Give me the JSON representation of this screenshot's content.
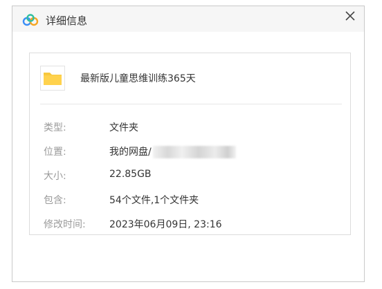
{
  "dialog": {
    "title": "详细信息",
    "app_icon": "cloud-logo-icon",
    "close_icon": "close-icon"
  },
  "file": {
    "icon": "folder-icon",
    "name": "最新版儿童思维训练365天"
  },
  "details": {
    "type_label": "类型:",
    "type_value": "文件夹",
    "location_label": "位置:",
    "location_value": "我的网盘/",
    "size_label": "大小:",
    "size_value": "22.85GB",
    "contains_label": "包含:",
    "contains_value": "54个文件,1个文件夹",
    "modified_label": "修改时间:",
    "modified_value": "2023年06月09日, 23:16"
  },
  "colors": {
    "folder": "#f7c83e",
    "logo_blue": "#3a8ef6",
    "logo_orange": "#f5a623"
  }
}
